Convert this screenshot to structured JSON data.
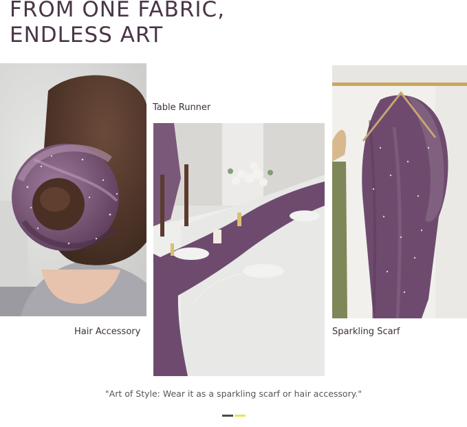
{
  "heading": {
    "line1": "FROM ONE FABRIC,",
    "line2": "ENDLESS ART"
  },
  "captions": {
    "table_runner": "Table Runner",
    "hair_accessory": "Hair Accessory",
    "sparkling_scarf": "Sparkling Scarf"
  },
  "quote": "\"Art of Style: Wear it as a sparkling scarf or hair accessory.\"",
  "colors": {
    "heading": "#4a3548",
    "fabric_purple": "#6e4b6e",
    "pager_active": "#4a4a4a",
    "pager_accent": "#e9e34a"
  }
}
